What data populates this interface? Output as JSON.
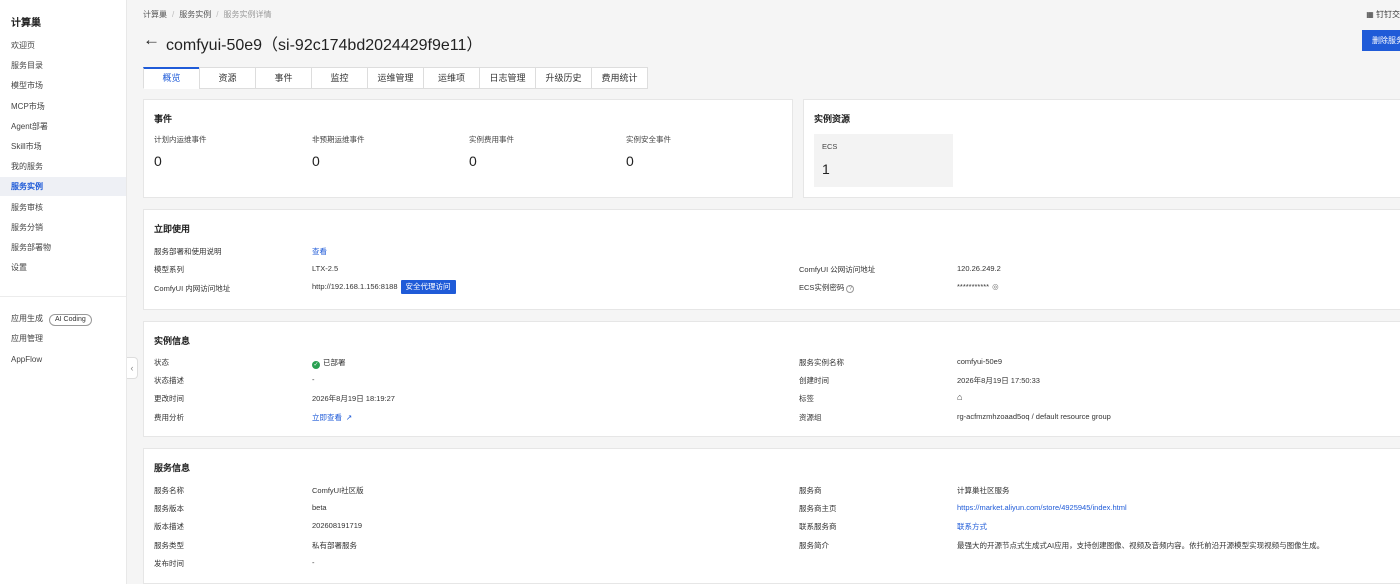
{
  "sidebar": {
    "title": "计算巢",
    "items": [
      {
        "label": "欢迎页"
      },
      {
        "label": "服务目录"
      },
      {
        "label": "模型市场"
      },
      {
        "label": "MCP市场"
      },
      {
        "label": "Agent部署"
      },
      {
        "label": "Skill市场"
      },
      {
        "label": "我的服务"
      },
      {
        "label": "服务实例"
      },
      {
        "label": "服务审核"
      },
      {
        "label": "服务分销"
      },
      {
        "label": "服务部署物"
      },
      {
        "label": "设置"
      }
    ],
    "bottom_items": [
      {
        "label": "应用生成",
        "badge": "AI Coding"
      },
      {
        "label": "应用管理"
      },
      {
        "label": "AppFlow"
      }
    ],
    "active_item": "服务实例",
    "collapse_icon": "chevron-left-icon"
  },
  "breadcrumb": [
    "计算巢",
    "服务实例",
    "服务实例详情"
  ],
  "top_right_link": "钉钉交",
  "header": {
    "title": "comfyui-50e9（si-92c174bd2024429f9e11）",
    "delete_button": "删除服务"
  },
  "tabs": [
    "概览",
    "资源",
    "事件",
    "监控",
    "运维管理",
    "运维项",
    "日志管理",
    "升级历史",
    "费用统计"
  ],
  "events_card": {
    "title": "事件",
    "stats": [
      {
        "label": "计划内运维事件",
        "value": "0"
      },
      {
        "label": "非预期运维事件",
        "value": "0"
      },
      {
        "label": "实例费用事件",
        "value": "0"
      },
      {
        "label": "实例安全事件",
        "value": "0"
      }
    ]
  },
  "resources_card": {
    "title": "实例资源",
    "ecs_label": "ECS",
    "ecs_value": "1"
  },
  "quick_use": {
    "title": "立即使用",
    "guide_label": "服务部署和使用说明",
    "guide_link": "查看",
    "model_label": "模型系列",
    "model_value": "LTX-2.5",
    "internal_label": "ComfyUI 内网访问地址",
    "internal_value": "http://192.168.1.156:8188",
    "proxy_button": "安全代理访问",
    "public_label": "ComfyUI 公网访问地址",
    "public_value": "120.26.249.2",
    "password_label": "ECS实例密码",
    "password_value": "***********"
  },
  "instance_info": {
    "title": "实例信息",
    "status_label": "状态",
    "status_value": "已部署",
    "status_desc_label": "状态描述",
    "status_desc_value": "-",
    "modified_label": "更改时间",
    "modified_value": "2026年8月19日 18:19:27",
    "cost_label": "费用分析",
    "cost_link": "立即查看",
    "name_label": "服务实例名称",
    "name_value": "comfyui-50e9",
    "created_label": "创建时间",
    "created_value": "2026年8月19日 17:50:33",
    "tags_label": "标签",
    "rg_label": "资源组",
    "rg_value": "rg-acfmzmhzoaad5oq / default resource group"
  },
  "service_info": {
    "title": "服务信息",
    "name_label": "服务名称",
    "name_value": "ComfyUI社区版",
    "version_label": "服务版本",
    "version_value": "beta",
    "version_desc_label": "版本描述",
    "version_desc_value": "202608191719",
    "type_label": "服务类型",
    "type_value": "私有部署服务",
    "publish_label": "发布时间",
    "publish_value": "-",
    "vendor_label": "服务商",
    "vendor_value": "计算巢社区服务",
    "homepage_label": "服务商主页",
    "homepage_value": "https://market.aliyun.com/store/4925945/index.html",
    "contact_label": "联系服务商",
    "contact_value": "联系方式",
    "intro_label": "服务简介",
    "intro_value": "最强大的开源节点式生成式AI应用，支持创建图像、视频及音频内容。依托前沿开源模型实现视频与图像生成。"
  },
  "colors": {
    "accent": "#1f5bd8",
    "success": "#2aa052",
    "page_bg": "#f5f5f5"
  }
}
